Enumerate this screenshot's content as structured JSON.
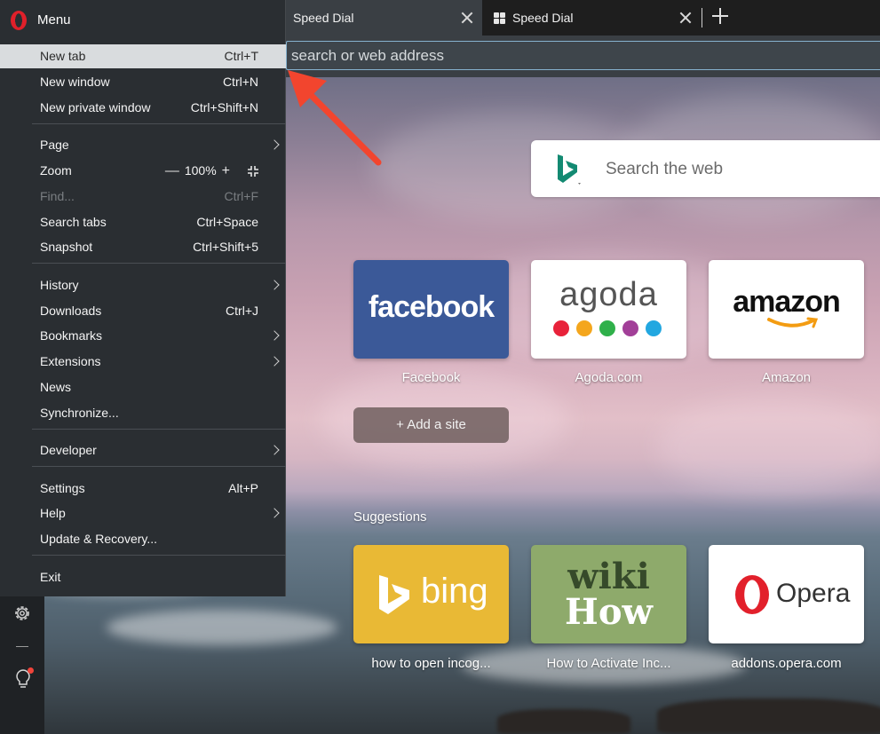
{
  "tabs": [
    {
      "label": "Speed Dial",
      "active": true
    },
    {
      "label": "Speed Dial",
      "active": false
    }
  ],
  "address_bar": {
    "placeholder": "search or web address"
  },
  "menu": {
    "title": "Menu",
    "items": [
      {
        "label": "New tab",
        "shortcut": "Ctrl+T"
      },
      {
        "label": "New window",
        "shortcut": "Ctrl+N"
      },
      {
        "label": "New private window",
        "shortcut": "Ctrl+Shift+N"
      },
      {
        "label": "Page",
        "shortcut": ""
      },
      {
        "label": "Zoom",
        "shortcut": ""
      },
      {
        "label": "Find...",
        "shortcut": "Ctrl+F"
      },
      {
        "label": "Search tabs",
        "shortcut": "Ctrl+Space"
      },
      {
        "label": "Snapshot",
        "shortcut": "Ctrl+Shift+5"
      },
      {
        "label": "History",
        "shortcut": ""
      },
      {
        "label": "Downloads",
        "shortcut": "Ctrl+J"
      },
      {
        "label": "Bookmarks",
        "shortcut": ""
      },
      {
        "label": "Extensions",
        "shortcut": ""
      },
      {
        "label": "News",
        "shortcut": ""
      },
      {
        "label": "Synchronize...",
        "shortcut": ""
      },
      {
        "label": "Developer",
        "shortcut": ""
      },
      {
        "label": "Settings",
        "shortcut": "Alt+P"
      },
      {
        "label": "Help",
        "shortcut": ""
      },
      {
        "label": "Update & Recovery...",
        "shortcut": ""
      },
      {
        "label": "Exit",
        "shortcut": ""
      }
    ],
    "zoom": {
      "minus": "—",
      "value": "100%",
      "plus": "+"
    }
  },
  "search": {
    "placeholder": "Search the web"
  },
  "speed_dial": [
    {
      "logo": "facebook",
      "caption": "Facebook"
    },
    {
      "logo": "agoda",
      "caption": "Agoda.com"
    },
    {
      "logo": "amazon",
      "caption": "Amazon"
    }
  ],
  "add_site": {
    "label": "+  Add a site"
  },
  "suggestions": {
    "heading": "Suggestions",
    "items": [
      {
        "logo": "bing",
        "caption": "how to open incog..."
      },
      {
        "logo_line1": "wiki",
        "logo_line2": "How",
        "caption": "How to Activate Inc..."
      },
      {
        "logo": "Opera",
        "caption": "addons.opera.com"
      }
    ]
  },
  "colors": {
    "accent": "#e0202a",
    "menu_bg": "#2a2e32",
    "highlight": "#d9dcde",
    "facebook": "#3b5998",
    "bing": "#e9b935",
    "wikihow": "#8eaa6b"
  }
}
